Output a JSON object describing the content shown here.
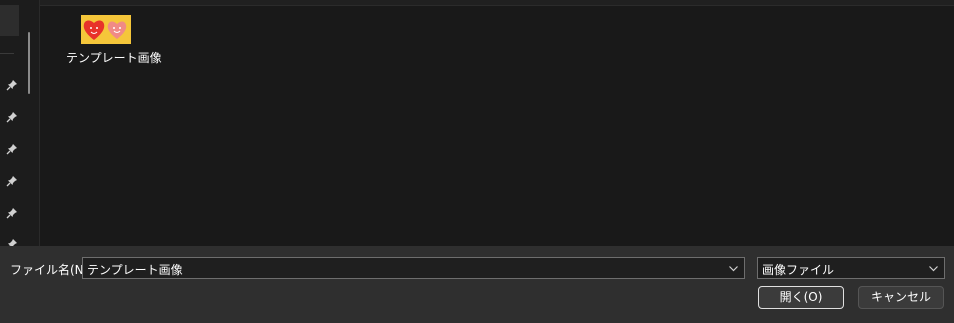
{
  "nav": {
    "pins": [
      "pin-icon",
      "pin-icon",
      "pin-icon",
      "pin-icon",
      "pin-icon",
      "pin-icon"
    ]
  },
  "files": [
    {
      "name": "テンプレート画像",
      "icon": "image-thumbnail"
    }
  ],
  "bottom": {
    "filename_label": "ファイル名(N):",
    "filename_value": "テンプレート画像",
    "filetype_value": "画像ファイル",
    "open_label": "開く(O)",
    "cancel_label": "キャンセル"
  },
  "colors": {
    "background": "#191919",
    "panel": "#2f2f2f",
    "thumbnail_bg": "#f5c63a",
    "heart_red": "#e8332a",
    "heart_pink": "#f08a86"
  }
}
